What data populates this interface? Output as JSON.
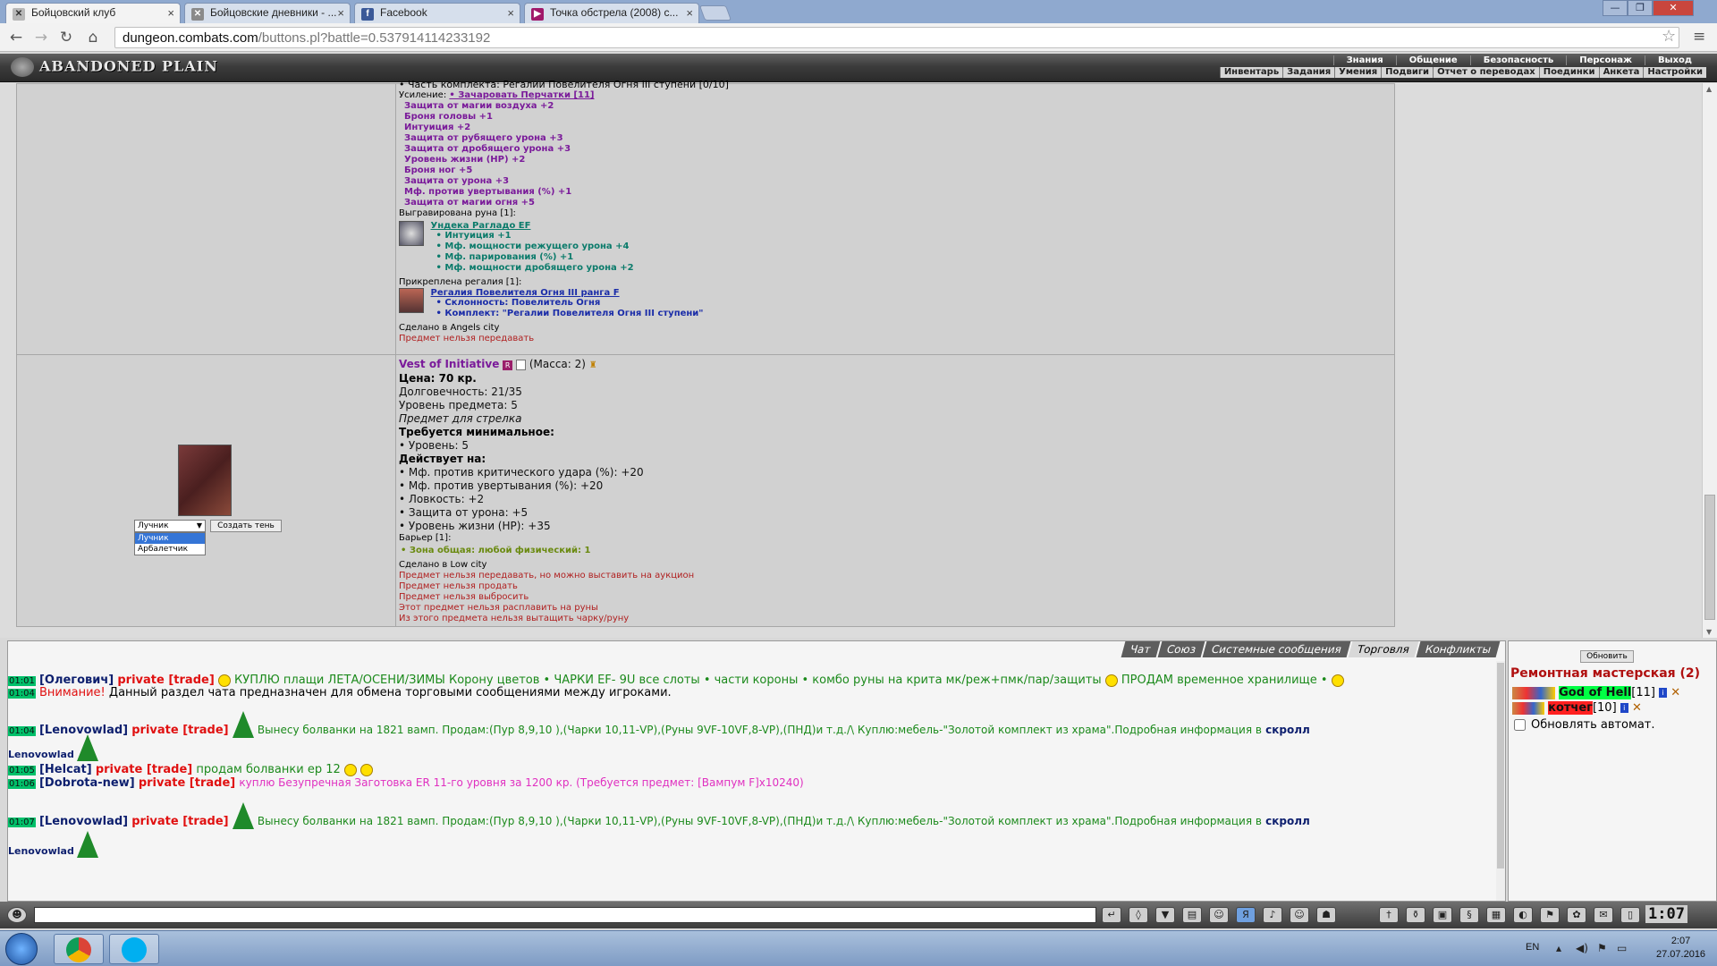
{
  "browser": {
    "tabs": [
      {
        "label": "Бойцовский клуб",
        "active": true
      },
      {
        "label": "Бойцовские дневники - ..."
      },
      {
        "label": "Facebook"
      },
      {
        "label": "Точка обстрела (2008) с..."
      }
    ],
    "url_host": "dungeon.combats.com",
    "url_path": "/buttons.pl?battle=0.537914114233192"
  },
  "game": {
    "logo": "ABANDONED PLAIN",
    "main_menu": [
      "Знания",
      "Общение",
      "Безопасность",
      "Персонаж",
      "Выход"
    ],
    "sub_menu": [
      "Инвентарь",
      "Задания",
      "Умения",
      "Подвиги",
      "Отчет о переводах",
      "Поединки",
      "Анкета",
      "Настройки"
    ]
  },
  "item1": {
    "set_line": "• Часть комплекта: Регалии Повелителя Огня III ступени [0/10]",
    "upgrade_label": "Усиление:",
    "upgrade_link": "• Зачаровать Перчатки [11]",
    "stats": [
      "Защита от магии воздуха +2",
      "Броня головы +1",
      "Интуиция +2",
      "Защита от рубящего урона +3",
      "Защита от дробящего урона +3",
      "Уровень жизни (HP) +2",
      "Броня ног +5",
      "Защита от урона +3",
      "Мф. против увертывания (%) +1",
      "Защита от магии огня +5"
    ],
    "rune_label": "Выгравирована руна [1]:",
    "rune_name": "Ундека Рагладо EF",
    "rune_stats": [
      "• Интуиция +1",
      "• Мф. мощности режущего урона +4",
      "• Мф. парирования (%) +1",
      "• Мф. мощности дробящего урона +2"
    ],
    "regalia_label": "Прикреплена регалия [1]:",
    "regalia_name": "Регалия Повелителя Огня III ранга F",
    "regalia_stats": [
      "• Склонность: Повелитель Огня",
      "• Комплект: \"Регалии Повелителя Огня III ступени\""
    ],
    "made_in": "Сделано в Angels city",
    "no_transfer": "Предмет нельзя передавать"
  },
  "item2": {
    "name": "Vest of Initiative",
    "mass": "(Масса: 2)",
    "price": "Цена: 70 кр.",
    "durability": "Долговечность: 21/35",
    "level": "Уровень предмета: 5",
    "for_class": "Предмет для стрелка",
    "req_header": "Требуется минимальное:",
    "req_level": "• Уровень: 5",
    "acts_header": "Действует на:",
    "effects": [
      "• Мф. против критического удара (%): +20",
      "• Мф. против увертывания (%): +20",
      "• Ловкость: +2",
      "• Защита от урона: +5",
      "• Уровень жизни (HP): +35"
    ],
    "barrier_label": "Барьер [1]:",
    "barrier_zone": "• Зона общая: любой физический: 1",
    "made_in": "Сделано в Low city",
    "restrictions": [
      "Предмет нельзя передавать, но можно выставить на аукцион",
      "Предмет нельзя продать",
      "Предмет нельзя выбросить",
      "Этот предмет нельзя расплавить на руны",
      "Из этого предмета нельзя вытащить чарку/руну"
    ],
    "class_select": "Лучник",
    "class_options": [
      "Лучник",
      "Арбалетчик"
    ],
    "shadow_button": "Создать тень"
  },
  "chat": {
    "tabs": [
      "Чат",
      "Союз",
      "Системные сообщения",
      "Торговля",
      "Конфликты"
    ],
    "active_tab": "Торговля",
    "messages": [
      {
        "time": "01:01",
        "nick": "[Олегович]",
        "tag": "private [trade]",
        "text": "КУПЛЮ плащи ЛЕТА/ОСЕНИ/ЗИМЫ Корону цветов • ЧАРКИ EF- 9U все слоты • части короны • комбо руны на крита мк/реж+пмк/пар/защиты",
        "text2": "ПРОДАМ временное хранилище •"
      },
      {
        "time": "01:04",
        "warn_label": "Внимание!",
        "text": "Данный раздел чата предназначен для обмена торговыми сообщениями между игроками."
      },
      {
        "time": "01:04",
        "nick": "[Lenovowlad]",
        "tag": "private [trade]",
        "text": "Вынесу болванки на 1821 вамп. Продам:(Пур 8,9,10 ),(Чарки 10,11-VP),(Руны 9VF-10VF,8-VP),(ПНД)и т.д./\\ Куплю:мебель-\"Золотой комплект из храма\".Подробная информация в",
        "scroll": "скролл",
        "signature": "Lenovowlad"
      },
      {
        "time": "01:05",
        "nick": "[Helcat]",
        "tag": "private [trade]",
        "text": "продам болванки ер 12"
      },
      {
        "time": "01:06",
        "nick": "[Dobrota-new]",
        "tag": "private [trade]",
        "text": "куплю Безупречная Заготовка ER 11-го уровня за 1200 кр. (Требуется предмет: [Вампум F]x10240)"
      },
      {
        "time": "01:07",
        "nick": "[Lenovowlad]",
        "tag": "private [trade]",
        "text": "Вынесу болванки на 1821 вамп. Продам:(Пур 8,9,10 ),(Чарки 10,11-VP),(Руны 9VF-10VF,8-VP),(ПНД)и т.д./\\ Куплю:мебель-\"Золотой комплект из храма\".Подробная информация в",
        "scroll": "скролл",
        "signature": "Lenovowlad"
      }
    ]
  },
  "workshop": {
    "refresh": "Обновить",
    "title": "Ремонтная мастерская (2)",
    "players": [
      {
        "name": "God of Hell",
        "level": "[11]"
      },
      {
        "name": "котчег",
        "level": "[10]"
      }
    ],
    "auto_refresh": "Обновлять автомат."
  },
  "clock": "1:07",
  "taskbar": {
    "lang": "EN",
    "time": "2:07",
    "date": "27.07.2016"
  }
}
